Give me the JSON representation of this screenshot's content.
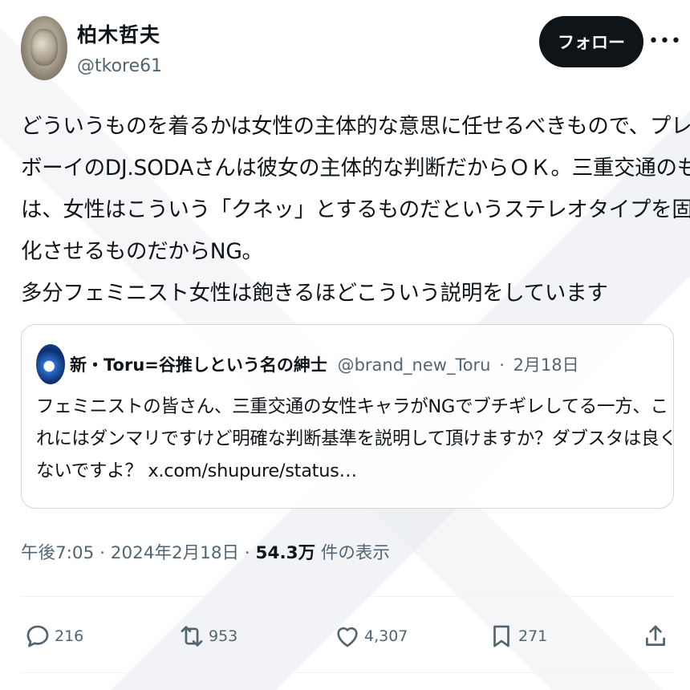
{
  "author": {
    "display_name": "柏木哲夫",
    "handle": "@tkore61"
  },
  "follow_label": "フォロー",
  "more_label": "•••",
  "body_lines": [
    "どういうものを着るかは女性の主体的な意思に任せるべきもので、プレイ",
    "ボーイのDJ.SODAさんは彼女の主体的な判断だからＯＫ。三重交通のもの",
    "は、女性はこういう「クネッ」とするものだというステレオタイプを固定",
    "化させるものだからNG。",
    "多分フェミニスト女性は飽きるほどこういう説明をしています"
  ],
  "quote": {
    "display_name": "新・Toru=谷推しという名の紳士",
    "handle": "@brand_new_Toru",
    "date": "2月18日",
    "separator": "·",
    "lines": [
      "フェミニストの皆さん、三重交通の女性キャラがNGでブチギレしてる一方、こ",
      "れにはダンマリですけど明確な判断基準を説明して頂けますか？ダブスタは良く",
      "ないですよ？ x.com/shupure/status…"
    ]
  },
  "meta": {
    "timestamp": "午後7:05 · 2024年2月18日 · ",
    "views_count": "54.3万",
    "views_label": " 件の表示"
  },
  "actions": {
    "reply_count": "216",
    "retweet_count": "953",
    "like_count": "4,307",
    "bookmark_count": "271"
  },
  "icons": {
    "reply": "reply-icon",
    "retweet": "retweet-icon",
    "like": "heart-icon",
    "bookmark": "bookmark-icon",
    "share": "share-icon"
  },
  "colors": {
    "text": "#0f1419",
    "muted": "#536471",
    "follow_bg": "#0f1419",
    "border": "#cfd9de"
  }
}
